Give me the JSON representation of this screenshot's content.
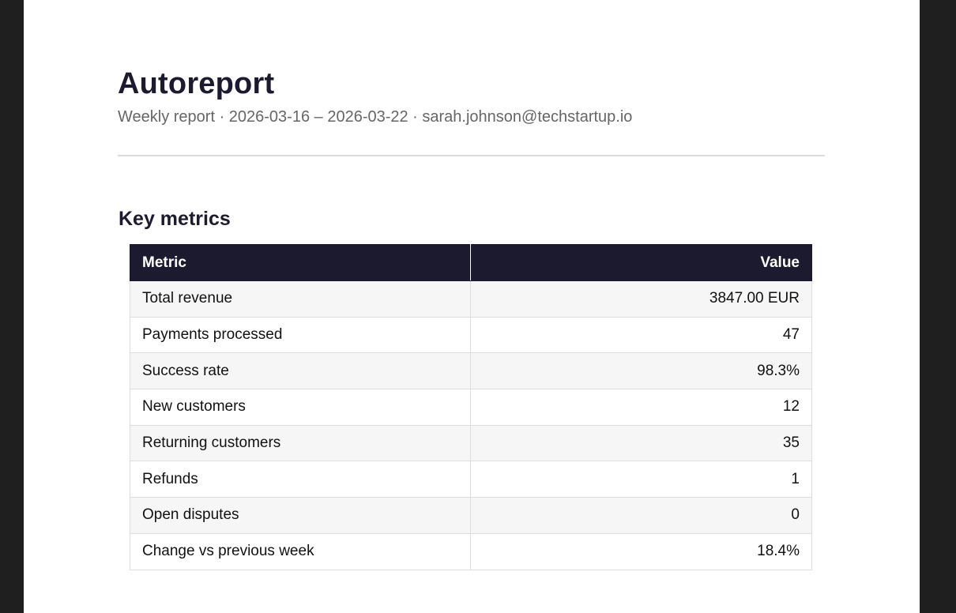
{
  "header": {
    "title": "Autoreport",
    "subtitle": "Weekly report · 2026-03-16 – 2026-03-22 · sarah.johnson@techstartup.io"
  },
  "section": {
    "title": "Key metrics"
  },
  "table": {
    "columns": [
      "Metric",
      "Value"
    ],
    "rows": [
      {
        "metric": "Total revenue",
        "value": "3847.00 EUR"
      },
      {
        "metric": "Payments processed",
        "value": "47"
      },
      {
        "metric": "Success rate",
        "value": "98.3%"
      },
      {
        "metric": "New customers",
        "value": "12"
      },
      {
        "metric": "Returning customers",
        "value": "35"
      },
      {
        "metric": "Refunds",
        "value": "1"
      },
      {
        "metric": "Open disputes",
        "value": "0"
      },
      {
        "metric": "Change vs previous week",
        "value": "18.4%"
      }
    ]
  },
  "colors": {
    "header_bg": "#1c1a2e",
    "page_bg": "#ffffff",
    "backdrop": "#1f1f1f",
    "stripe": "#f6f6f6"
  }
}
